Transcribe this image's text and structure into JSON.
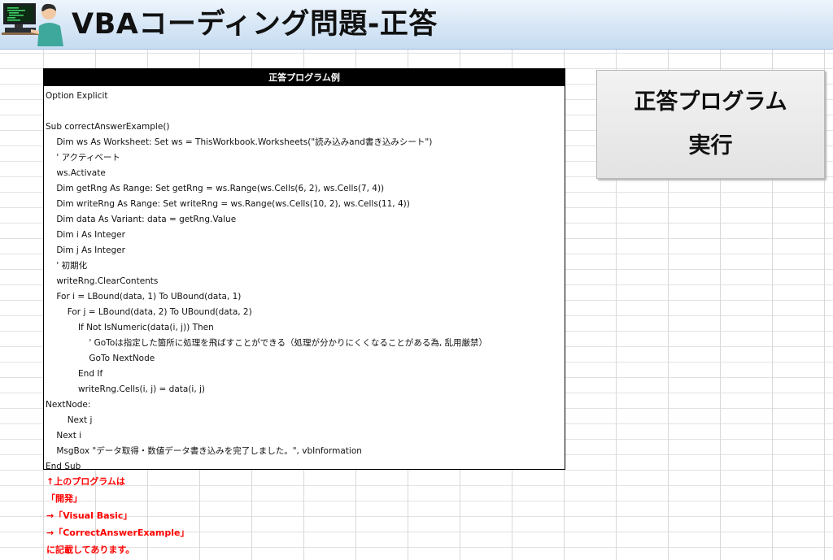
{
  "header": {
    "title": "VBAコーディング問題-正答",
    "logo_icon": "programmer-at-computer-icon"
  },
  "code_panel": {
    "title": "正答プログラム例",
    "lines": [
      "Option Explicit",
      "",
      "Sub correctAnswerExample()",
      "    Dim ws As Worksheet: Set ws = ThisWorkbook.Worksheets(\"読み込みand書き込みシート\")",
      "    ' アクティベート",
      "    ws.Activate",
      "    Dim getRng As Range: Set getRng = ws.Range(ws.Cells(6, 2), ws.Cells(7, 4))",
      "    Dim writeRng As Range: Set writeRng = ws.Range(ws.Cells(10, 2), ws.Cells(11, 4))",
      "    Dim data As Variant: data = getRng.Value",
      "    Dim i As Integer",
      "    Dim j As Integer",
      "    ' 初期化",
      "    writeRng.ClearContents",
      "    For i = LBound(data, 1) To UBound(data, 1)",
      "        For j = LBound(data, 2) To UBound(data, 2)",
      "            If Not IsNumeric(data(i, j)) Then",
      "                ' GoToは指定した箇所に処理を飛ばすことができる（処理が分かりにくくなることがある為, 乱用厳禁）",
      "                GoTo NextNode",
      "            End If",
      "            writeRng.Cells(i, j) = data(i, j)",
      "NextNode:",
      "        Next j",
      "    Next i",
      "    MsgBox \"データ取得・数値データ書き込みを完了しました。\", vbInformation",
      "End Sub"
    ]
  },
  "run_button": {
    "line1": "正答プログラム",
    "line2": "実行"
  },
  "notes": {
    "color": "#ff0000",
    "lines": [
      "↑上のプログラムは",
      "「開発」",
      "→「Visual Basic」",
      "→「CorrectAnswerExample」",
      "に記載してあります。"
    ]
  }
}
